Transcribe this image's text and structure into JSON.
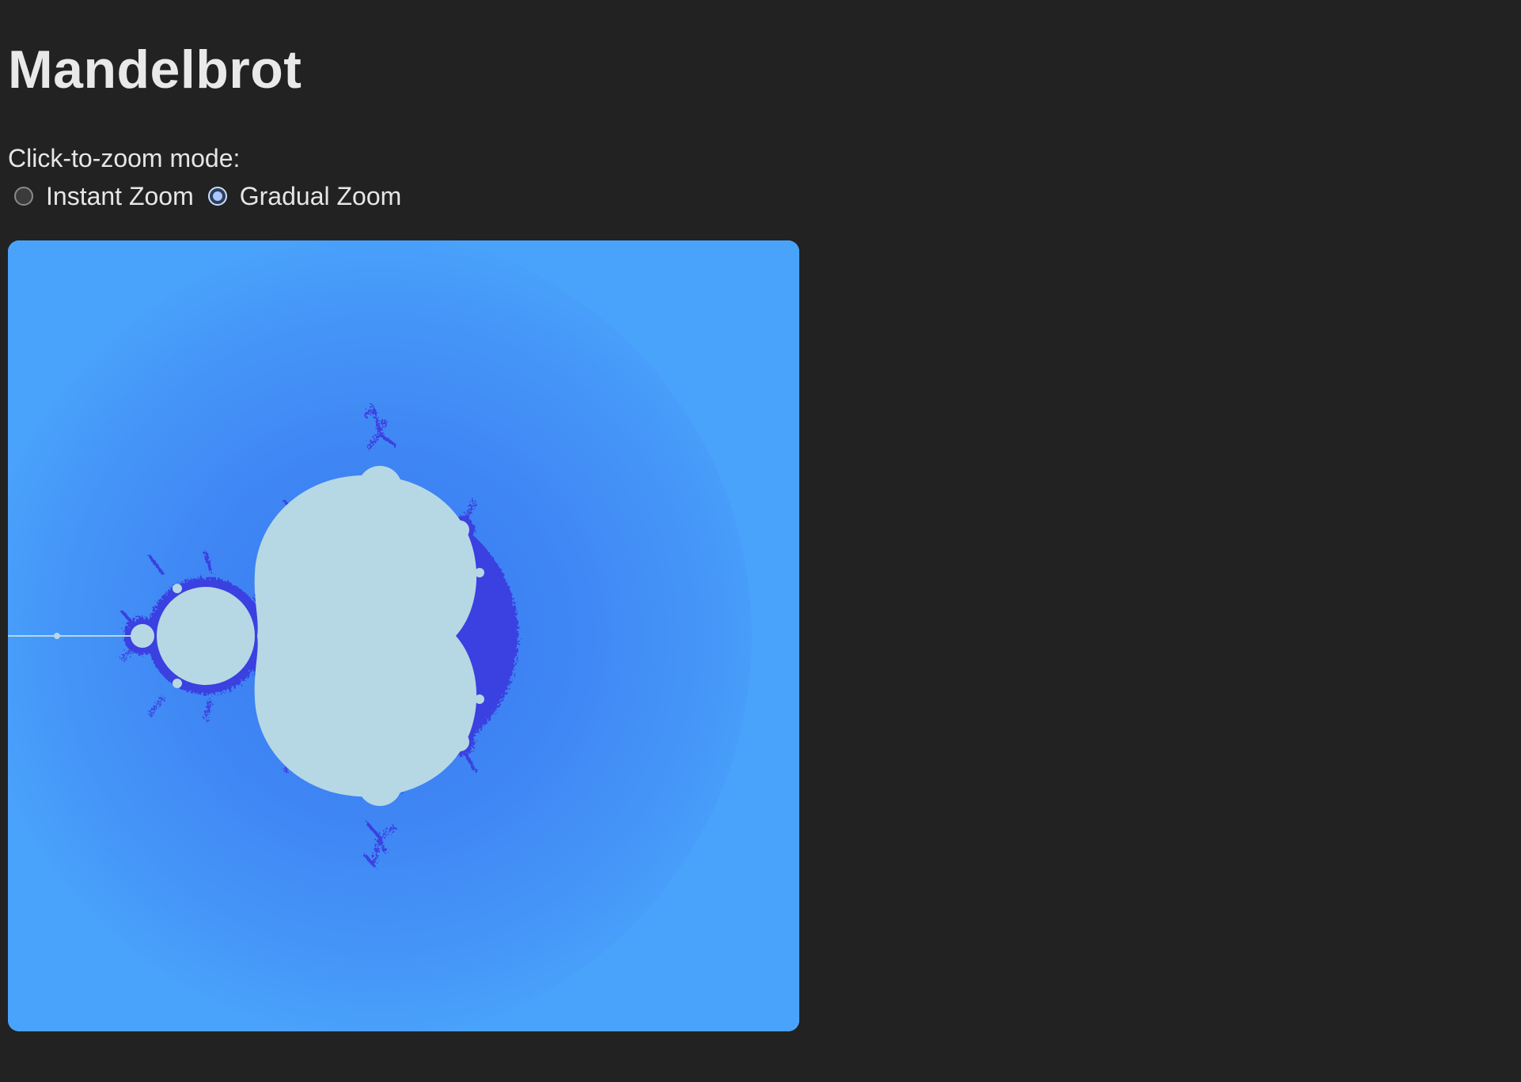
{
  "page": {
    "title": "Mandelbrot"
  },
  "zoom_mode": {
    "label": "Click-to-zoom mode:",
    "options": [
      {
        "label": "Instant Zoom",
        "selected": false
      },
      {
        "label": "Gradual Zoom",
        "selected": true
      }
    ]
  },
  "colors": {
    "background": "#222222",
    "canvas_outer": "#4aa3fb",
    "canvas_inner": "#3f86f4",
    "set_fill": "#b6d8e4",
    "fringe": "#3b3fe0",
    "fringe_accent": "#d46bd6"
  }
}
